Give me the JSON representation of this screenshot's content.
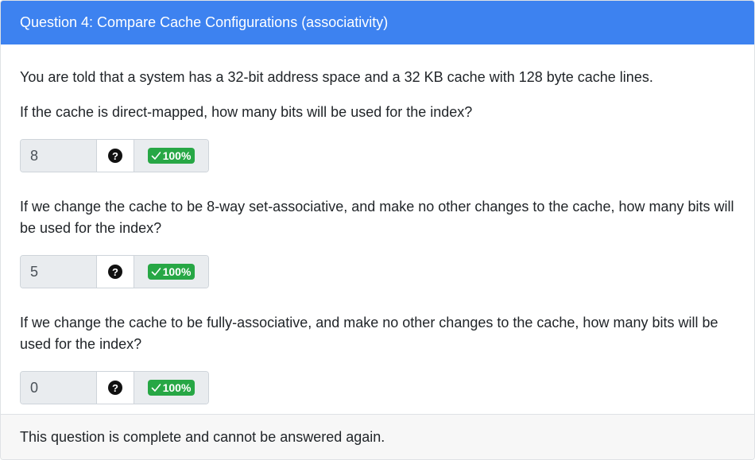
{
  "header": {
    "title": "Question 4: Compare Cache Configurations (associativity)"
  },
  "body": {
    "intro": "You are told that a system has a 32-bit address space and a 32 KB cache with 128 byte cache lines.",
    "questions": [
      {
        "prompt": "If the cache is direct-mapped, how many bits will be used for the index?",
        "answer": "8",
        "help_icon": "question-circle-icon",
        "score": "100%",
        "score_icon": "check-icon"
      },
      {
        "prompt": "If we change the cache to be 8-way set-associative, and make no other changes to the cache, how many bits will be used for the index?",
        "answer": "5",
        "help_icon": "question-circle-icon",
        "score": "100%",
        "score_icon": "check-icon"
      },
      {
        "prompt": "If we change the cache to be fully-associative, and make no other changes to the cache, how many bits will be used for the index?",
        "answer": "0",
        "help_icon": "question-circle-icon",
        "score": "100%",
        "score_icon": "check-icon"
      }
    ]
  },
  "footer": {
    "status": "This question is complete and cannot be answered again."
  },
  "colors": {
    "header_bg": "#3d82f0",
    "success_badge": "#27a745",
    "input_bg": "#e9ecef",
    "footer_bg": "#f7f7f7"
  }
}
